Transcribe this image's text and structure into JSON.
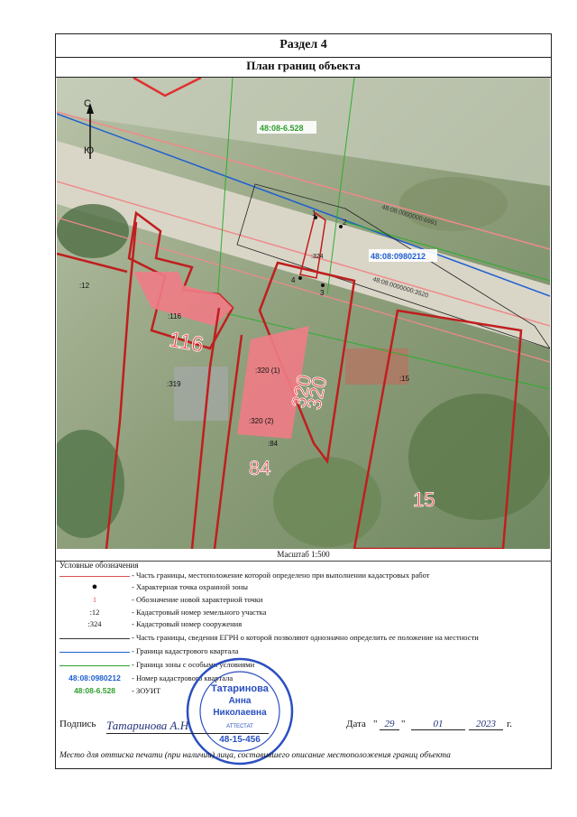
{
  "header": {
    "section": "Раздел 4",
    "title": "План границ объекта"
  },
  "map": {
    "north_label": "С",
    "south_label": "Ю",
    "zone_label": "48:08-6.528",
    "quarter_label": "48:08:0980212",
    "line_label_1": "48:08:0000000:6991",
    "line_label_2": "48:08:0000000:3520",
    "parcels": [
      ":12",
      ":116",
      ":319",
      ":320 (1)",
      ":320 (2)",
      ":84",
      ":15",
      ":324"
    ],
    "big_numbers": [
      "116",
      "320",
      "320",
      "84",
      "15"
    ],
    "points": [
      "1",
      "2",
      "3",
      "4"
    ]
  },
  "scale": "Масштаб 1:500",
  "legend": {
    "title": "Условные обозначения",
    "rows": [
      {
        "sym": "",
        "text": "- Часть границы, местоположение которой определено при выполнении кадастровых работ"
      },
      {
        "sym": "●",
        "text": "- Характерная точка охранной зоны"
      },
      {
        "sym": "1",
        "text": "- Обозначение новой характерной точки"
      },
      {
        "sym": ":12",
        "text": "- Кадастровый номер земельного участка"
      },
      {
        "sym": ":324",
        "text": "- Кадастровый номер сооружения"
      },
      {
        "sym": "",
        "text": "- Часть границы, сведения ЕГРН о которой позволяют однозначно определить ее положение на местности"
      },
      {
        "sym": "",
        "text": "- Граница кадастрового квартала"
      },
      {
        "sym": "",
        "text": "- Граница зоны с особыми условиями"
      },
      {
        "sym": "48:08:0980212",
        "text": "- Номер кадастрового квартала"
      },
      {
        "sym": "48:08-6.528",
        "text": "- ЗОУИТ"
      }
    ],
    "colors": {
      "red": "#e05050",
      "blue": "#1e5fd0",
      "green": "#2f9e2f",
      "dark": "#333333"
    }
  },
  "signature": {
    "label": "Подпись",
    "name": "Татаринова А.Н",
    "date_label": "Дата",
    "day": "29",
    "month": "01",
    "year": "2023",
    "year_suffix": "г."
  },
  "stamp": {
    "name1": "Татаринова",
    "name2": "Анна",
    "name3": "Николаевна",
    "reg": "48-15-456",
    "word": "АТТЕСТАТ"
  },
  "footer_note": "Место для оттиска печати (при наличии) лица, составившего описание местоположения границ объекта"
}
